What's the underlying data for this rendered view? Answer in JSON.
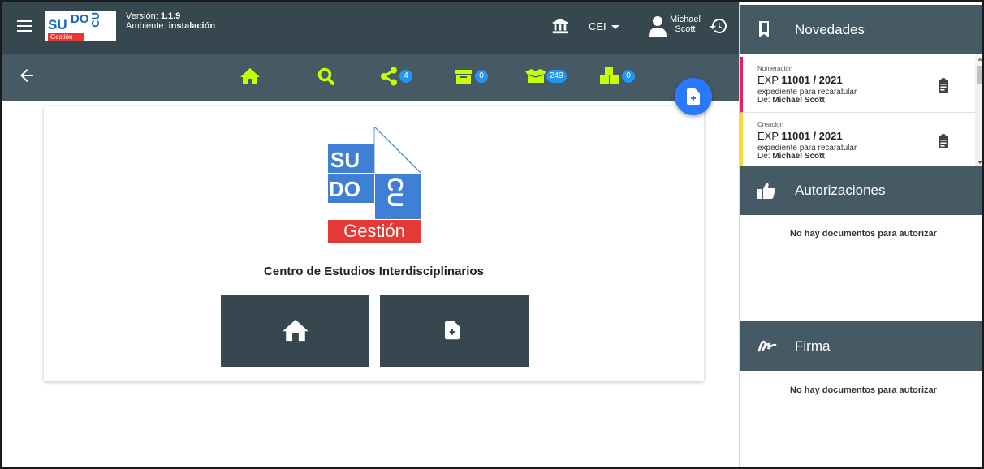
{
  "header": {
    "logo": {
      "su": "SU",
      "do": "DO",
      "cu": "CU",
      "gestion": "Gestión"
    },
    "version_label": "Versión:",
    "version_value": "1.1.9",
    "env_label": "Ambiente:",
    "env_value": "instalación",
    "org_selector": "CEI",
    "user_first": "Michael",
    "user_last": "Scott"
  },
  "toolbar": {
    "badges": {
      "shared": "4",
      "archive": "0",
      "inbox": "249",
      "pending": "0"
    },
    "colors": {
      "icon": "#c6ff00",
      "badge": "#2196f3",
      "fab": "#2979ff"
    }
  },
  "main": {
    "logo": {
      "su": "SU",
      "do": "DO",
      "cu": "CU",
      "gestion": "Gestión"
    },
    "org_name": "Centro de Estudios Interdisciplinarios"
  },
  "right_panel": {
    "novedades": {
      "title": "Novedades",
      "items": [
        {
          "type": "Numeración",
          "prefix": "EXP",
          "number": "11001 / 2021",
          "desc": "expediente para recaratular",
          "from_label": "De:",
          "from": "Michael Scott",
          "color": "#e91e63"
        },
        {
          "type": "Creacion",
          "prefix": "EXP",
          "number": "11001 / 2021",
          "desc": "expediente para recaratular",
          "from_label": "De:",
          "from": "Michael Scott",
          "color": "#fdd835"
        }
      ]
    },
    "autorizaciones": {
      "title": "Autorizaciones",
      "empty": "No hay documentos para autorizar"
    },
    "firma": {
      "title": "Firma",
      "empty": "No hay documentos para autorizar"
    }
  }
}
